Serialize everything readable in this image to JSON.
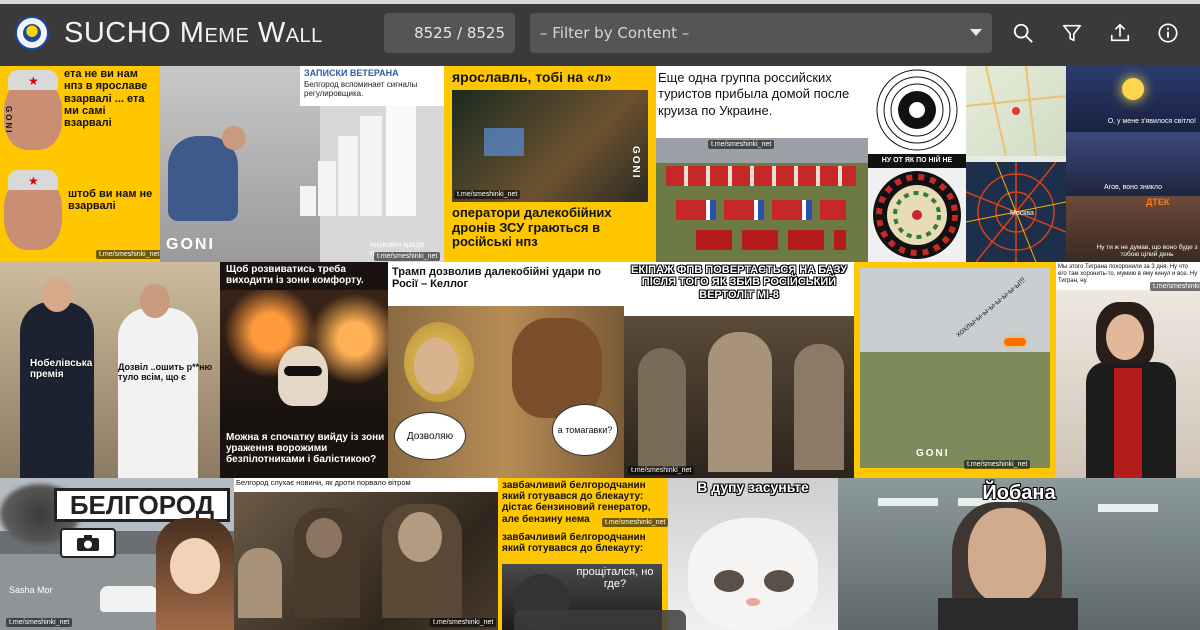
{
  "header": {
    "title": "SUCHO Meme Wall",
    "counter": "8525 / 8525",
    "filter_placeholder": "– Filter by Content –",
    "icons": [
      "search-icon",
      "filter-icon",
      "upload-icon",
      "info-icon"
    ]
  },
  "colors": {
    "accent_yellow": "#ffc700",
    "bar": "#3a3a3a",
    "field": "#555555"
  },
  "memes": {
    "m1": {
      "top": "ета не ви нам нпз в ярославе взарвалі ... ета ми самі взарвалі",
      "bottom": "штоб ви нам не взарвалі",
      "src": "t.me/smeshinki_net",
      "logo": "GONI"
    },
    "m2": {
      "header": "ЗАПИСКИ ВЕТЕРАНА",
      "sub": "Белгород вспоминает сигналы регулировщика.",
      "caption": "януковіч краде першу шапку",
      "logo": "GONI",
      "src": "t.me/smeshinki_net"
    },
    "m3": {
      "top": "ярославль, тобі на «л»",
      "bottom": "оператори далекобійних дронів ЗСУ граються в російські нпз",
      "src": "t.me/smeshinki_net",
      "logo": "GONI"
    },
    "m4": {
      "top": "Еще одна группа российских туристов прибыла домой после круиза по Украине.",
      "src": "t.me/smeshinki_net"
    },
    "m5": {
      "caption": "НУ ОТ ЯК ПО НІЙ НЕ СТРІЛЯТИ?!"
    },
    "m6": {
      "label": "Москва"
    },
    "m7": {
      "top": "О, у мене з'явилося світло!",
      "mid": " Агов, воно зникло",
      "bottom": "Ну ти ж не думав, що воно буде з тобою цілий день",
      "brand": "ДТЕК"
    },
    "m8": {
      "left": "Нобелівська премія",
      "right": "Дозвіл ..ошить р**ню туло всім, що є"
    },
    "m9": {
      "top": "Щоб розвиватись треба виходити із зони комфорту.",
      "bottom": "Можна я спочатку вийду із зони ураження ворожими безпілотниками і балістикою?"
    },
    "m10": {
      "top": "Трамп дозволив далекобійні удари по Росії – Келлог",
      "left": "Дозволяю",
      "right": "а томагавки?"
    },
    "m11": {
      "top": "ЕКІПАЖ ФПВ ПОВЕРТАЄТЬСЯ НА БАЗУ ПІСЛЯ ТОГО ЯК ЗБИВ РОСІЙСЬКИЙ ВЕРТОЛІТ МІ-8",
      "src": "t.me/smeshinki_net"
    },
    "m12": {
      "caption": "хохлы-ы-ы-ы-ы-ы-ы-ы!!!",
      "logo": "GONI",
      "src": "t.me/smeshinki_net"
    },
    "m13": {
      "top": "Мы этого Тиграна похоронили за 3 дня. Ну что его там хоронить-то, мумию в яму кинул и все. Ну Тигран, ну.",
      "src": "t.me/smeshinki_net"
    },
    "m14": {
      "sign": "БЕЛГОРОД",
      "src": "Sasha Mor",
      "src2": "t.me/smeshinki_net"
    },
    "m15": {
      "top": "Белгород слухає новини, як дроти порвало вітром",
      "src": "t.me/smeshinki_net"
    },
    "m16": {
      "top": "завбачливий белгородчанин який готувався до блекауту: дістає бензиновий генератор, але бензину нема",
      "bottom": "завбачливий белгородчанин який готувався до блекауту:",
      "bubble": "прощітался, но где?",
      "src": "t.me/smeshinki_net"
    },
    "m17": {
      "top": "В дупу засуньте"
    },
    "m18": {
      "top": "Йобана"
    }
  }
}
